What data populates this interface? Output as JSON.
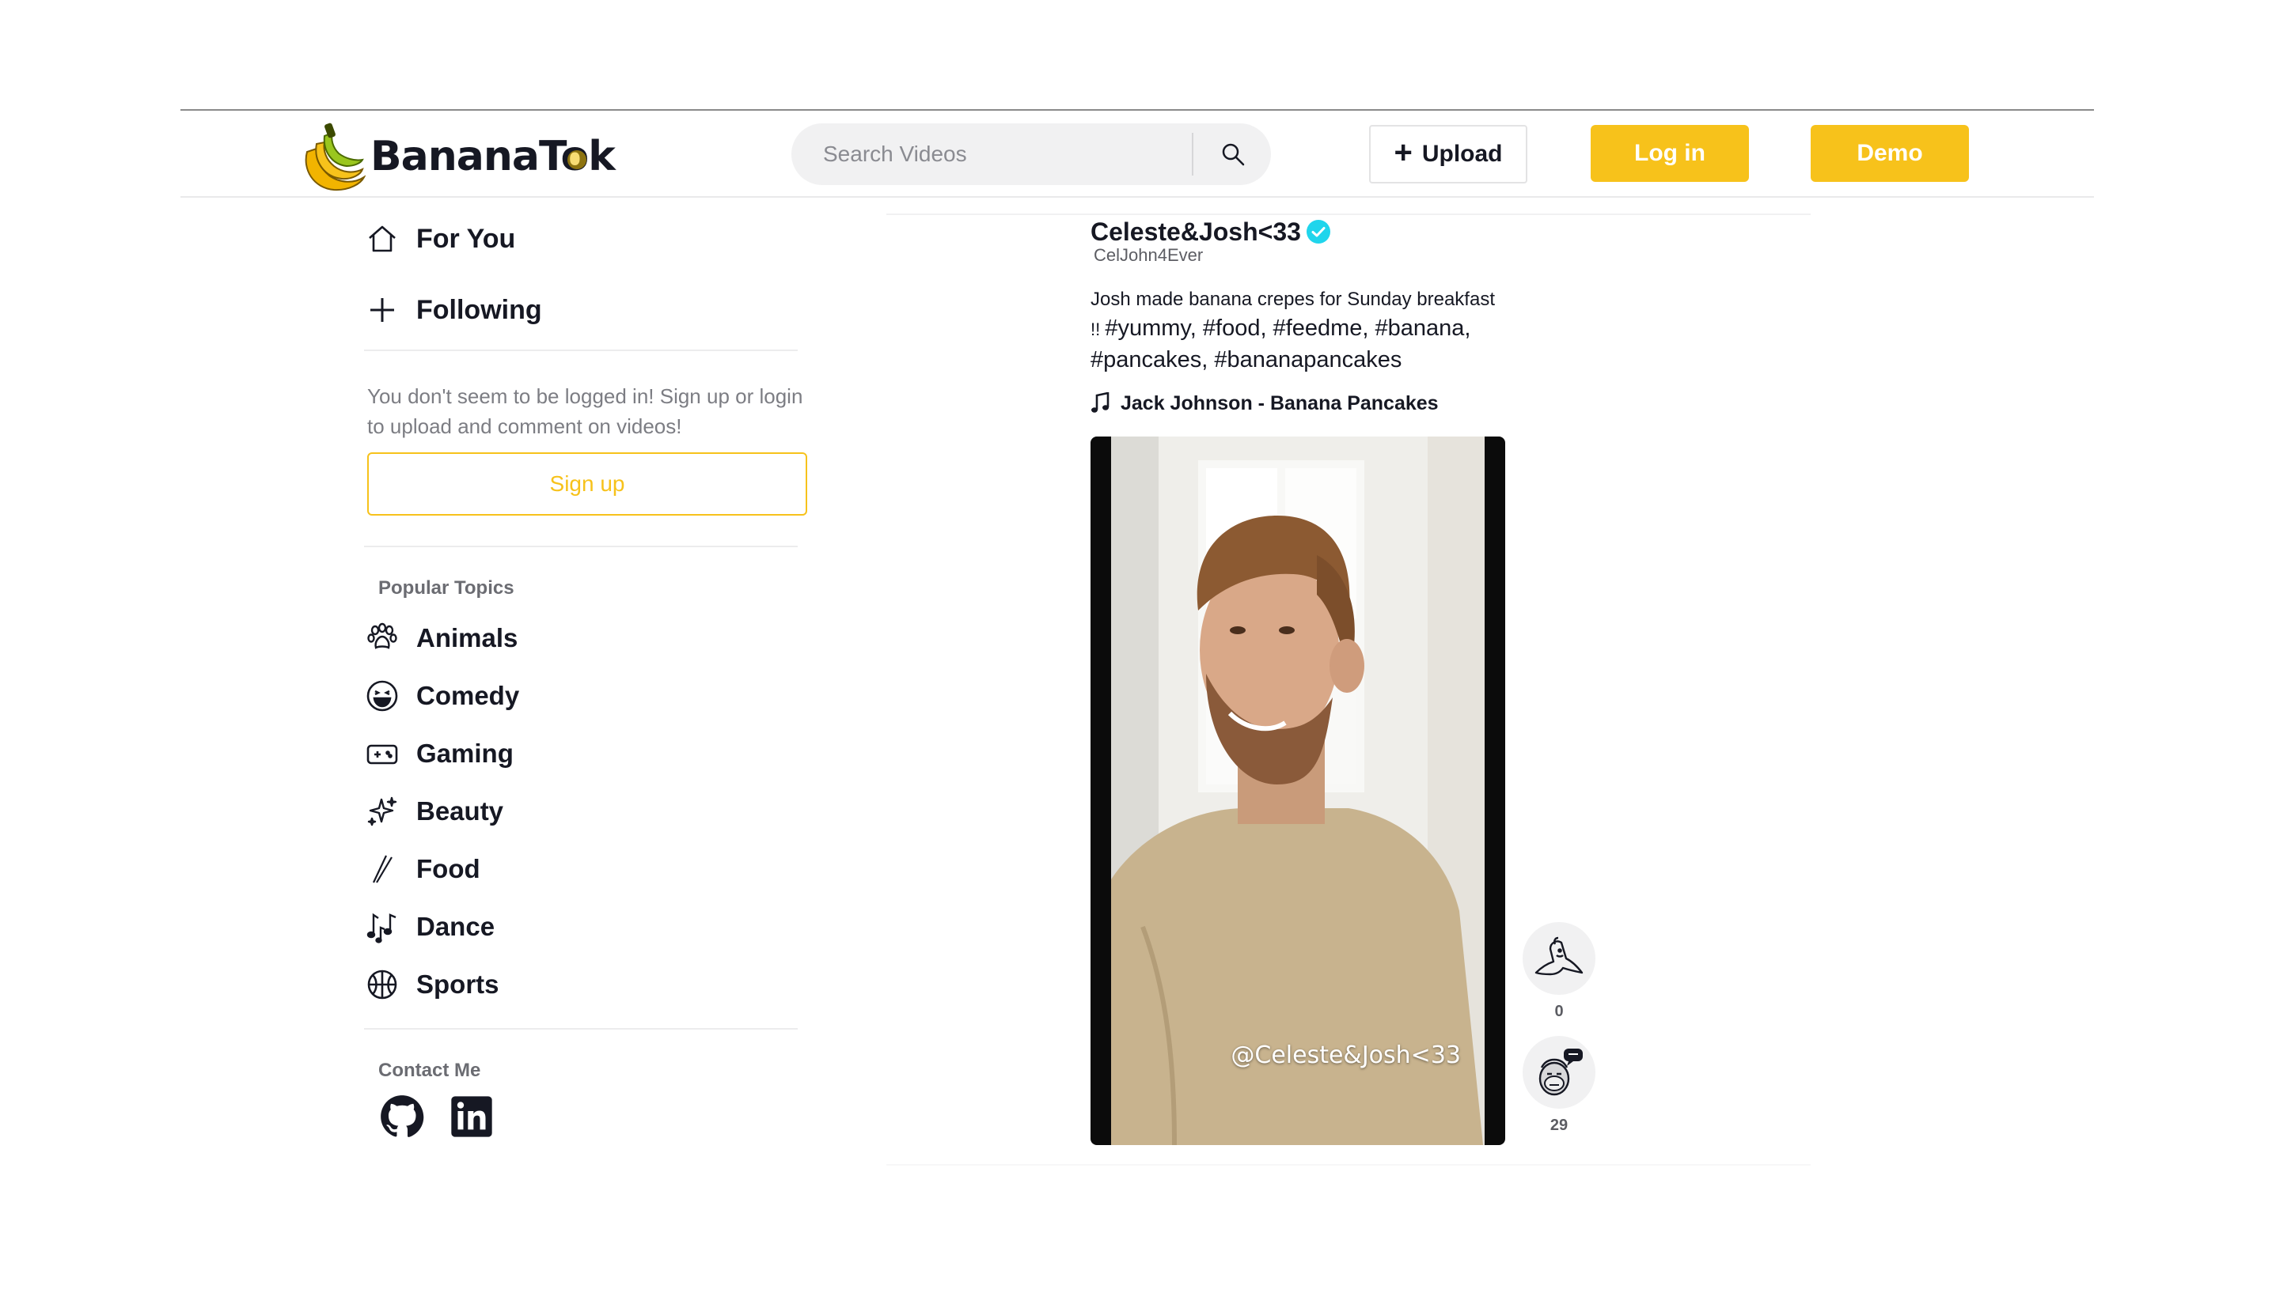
{
  "app": {
    "name_part1": "Banana",
    "name_t": "T",
    "name_o": "o",
    "name_k": "k"
  },
  "search": {
    "placeholder": "Search Videos"
  },
  "header": {
    "upload_label": "Upload",
    "login_label": "Log in",
    "demo_label": "Demo"
  },
  "sidebar": {
    "nav": [
      {
        "label": "For You",
        "icon": "home-icon"
      },
      {
        "label": "Following",
        "icon": "plus-icon"
      }
    ],
    "login_message": "You don't seem to be logged in! Sign up or login to upload and comment on videos!",
    "signup_label": "Sign up",
    "topics_title": "Popular Topics",
    "topics": [
      {
        "label": "Animals",
        "icon": "paw-icon"
      },
      {
        "label": "Comedy",
        "icon": "laughing-face-icon"
      },
      {
        "label": "Gaming",
        "icon": "gamepad-icon"
      },
      {
        "label": "Beauty",
        "icon": "sparkles-icon"
      },
      {
        "label": "Food",
        "icon": "chopsticks-icon"
      },
      {
        "label": "Dance",
        "icon": "music-notes-icon"
      },
      {
        "label": "Sports",
        "icon": "basketball-icon"
      }
    ],
    "contact_title": "Contact Me",
    "contact": [
      {
        "icon": "github-icon"
      },
      {
        "icon": "linkedin-icon"
      }
    ]
  },
  "post": {
    "author_name": "Celeste&Josh<33",
    "handle": "CelJohn4Ever",
    "caption_text": "Josh made banana crepes for Sunday breakfast",
    "caption_bang": "!! ",
    "caption_tags_line1": "#yummy, #food, #feedme, #banana,",
    "caption_tags_line2": "#pancakes, #bananapancakes",
    "music": "Jack Johnson - Banana Pancakes",
    "video_watermark": "@Celeste&Josh<33",
    "likes": "0",
    "comments": "29"
  },
  "colors": {
    "accent": "#f7c21b",
    "verified": "#20d5ec",
    "text": "#161823"
  }
}
